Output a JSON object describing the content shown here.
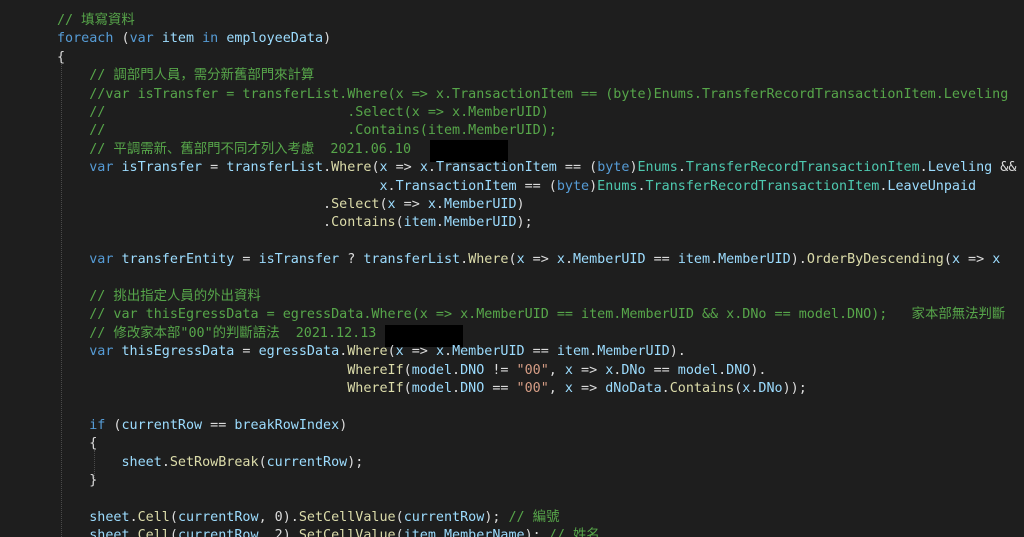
{
  "colors": {
    "background": "#1e1e1e",
    "comment": "#57a64a",
    "keyword": "#569cd6",
    "type": "#4ec9b0",
    "method": "#dcdcaa",
    "variable": "#9cdcfe",
    "string": "#d69d85",
    "plain": "#dcdcdc"
  },
  "lines": [
    [
      [
        "c",
        "// 填寫資料"
      ]
    ],
    [
      [
        "k",
        "foreach"
      ],
      [
        "p",
        " ("
      ],
      [
        "k",
        "var"
      ],
      [
        "p",
        " "
      ],
      [
        "v",
        "item"
      ],
      [
        "p",
        " "
      ],
      [
        "k",
        "in"
      ],
      [
        "p",
        " "
      ],
      [
        "v",
        "employeeData"
      ],
      [
        "p",
        ")"
      ]
    ],
    [
      [
        "p",
        "{"
      ]
    ],
    [
      [
        "c",
        "    // 調部門人員，需分新舊部門來計算"
      ]
    ],
    [
      [
        "c",
        "    //var isTransfer = transferList.Where(x => x.TransactionItem == (byte)Enums.TransferRecordTransactionItem.Leveling"
      ]
    ],
    [
      [
        "c",
        "    //                              .Select(x => x.MemberUID)"
      ]
    ],
    [
      [
        "c",
        "    //                              .Contains(item.MemberUID);"
      ]
    ],
    [
      [
        "c",
        "    // 平調需新、舊部門不同才列入考慮  2021.06.10"
      ]
    ],
    [
      [
        "p",
        "    "
      ],
      [
        "k",
        "var"
      ],
      [
        "p",
        " "
      ],
      [
        "v",
        "isTransfer"
      ],
      [
        "p",
        " = "
      ],
      [
        "v",
        "transferList"
      ],
      [
        "p",
        "."
      ],
      [
        "m",
        "Where"
      ],
      [
        "p",
        "("
      ],
      [
        "v",
        "x"
      ],
      [
        "p",
        " => "
      ],
      [
        "v",
        "x"
      ],
      [
        "p",
        "."
      ],
      [
        "v",
        "TransactionItem"
      ],
      [
        "p",
        " == ("
      ],
      [
        "k",
        "byte"
      ],
      [
        "p",
        ")"
      ],
      [
        "t",
        "Enums"
      ],
      [
        "p",
        "."
      ],
      [
        "t",
        "TransferRecordTransactionItem"
      ],
      [
        "p",
        "."
      ],
      [
        "v",
        "Leveling"
      ],
      [
        "p",
        " &&"
      ]
    ],
    [
      [
        "p",
        "                                        "
      ],
      [
        "v",
        "x"
      ],
      [
        "p",
        "."
      ],
      [
        "v",
        "TransactionItem"
      ],
      [
        "p",
        " == ("
      ],
      [
        "k",
        "byte"
      ],
      [
        "p",
        ")"
      ],
      [
        "t",
        "Enums"
      ],
      [
        "p",
        "."
      ],
      [
        "t",
        "TransferRecordTransactionItem"
      ],
      [
        "p",
        "."
      ],
      [
        "v",
        "LeaveUnpaid"
      ]
    ],
    [
      [
        "p",
        "                                 ."
      ],
      [
        "m",
        "Select"
      ],
      [
        "p",
        "("
      ],
      [
        "v",
        "x"
      ],
      [
        "p",
        " => "
      ],
      [
        "v",
        "x"
      ],
      [
        "p",
        "."
      ],
      [
        "v",
        "MemberUID"
      ],
      [
        "p",
        ")"
      ]
    ],
    [
      [
        "p",
        "                                 ."
      ],
      [
        "m",
        "Contains"
      ],
      [
        "p",
        "("
      ],
      [
        "v",
        "item"
      ],
      [
        "p",
        "."
      ],
      [
        "v",
        "MemberUID"
      ],
      [
        "p",
        ");"
      ]
    ],
    [],
    [
      [
        "p",
        "    "
      ],
      [
        "k",
        "var"
      ],
      [
        "p",
        " "
      ],
      [
        "v",
        "transferEntity"
      ],
      [
        "p",
        " = "
      ],
      [
        "v",
        "isTransfer"
      ],
      [
        "p",
        " ? "
      ],
      [
        "v",
        "transferList"
      ],
      [
        "p",
        "."
      ],
      [
        "m",
        "Where"
      ],
      [
        "p",
        "("
      ],
      [
        "v",
        "x"
      ],
      [
        "p",
        " => "
      ],
      [
        "v",
        "x"
      ],
      [
        "p",
        "."
      ],
      [
        "v",
        "MemberUID"
      ],
      [
        "p",
        " == "
      ],
      [
        "v",
        "item"
      ],
      [
        "p",
        "."
      ],
      [
        "v",
        "MemberUID"
      ],
      [
        "p",
        ")."
      ],
      [
        "m",
        "OrderByDescending"
      ],
      [
        "p",
        "("
      ],
      [
        "v",
        "x"
      ],
      [
        "p",
        " => "
      ],
      [
        "v",
        "x"
      ]
    ],
    [],
    [
      [
        "c",
        "    // 挑出指定人員的外出資料"
      ]
    ],
    [
      [
        "c",
        "    // var thisEgressData = egressData.Where(x => x.MemberUID == item.MemberUID && x.DNo == model.DNO);   家本部無法判斷"
      ]
    ],
    [
      [
        "c",
        "    // 修改家本部\"00\"的判斷語法  2021.12.13"
      ]
    ],
    [
      [
        "p",
        "    "
      ],
      [
        "k",
        "var"
      ],
      [
        "p",
        " "
      ],
      [
        "v",
        "thisEgressData"
      ],
      [
        "p",
        " = "
      ],
      [
        "v",
        "egressData"
      ],
      [
        "p",
        "."
      ],
      [
        "m",
        "Where"
      ],
      [
        "p",
        "("
      ],
      [
        "v",
        "x"
      ],
      [
        "p",
        " => "
      ],
      [
        "v",
        "x"
      ],
      [
        "p",
        "."
      ],
      [
        "v",
        "MemberUID"
      ],
      [
        "p",
        " == "
      ],
      [
        "v",
        "item"
      ],
      [
        "p",
        "."
      ],
      [
        "v",
        "MemberUID"
      ],
      [
        "p",
        ")."
      ]
    ],
    [
      [
        "p",
        "                                    "
      ],
      [
        "m",
        "WhereIf"
      ],
      [
        "p",
        "("
      ],
      [
        "v",
        "model"
      ],
      [
        "p",
        "."
      ],
      [
        "v",
        "DNO"
      ],
      [
        "p",
        " != "
      ],
      [
        "s",
        "\"00\""
      ],
      [
        "p",
        ", "
      ],
      [
        "v",
        "x"
      ],
      [
        "p",
        " => "
      ],
      [
        "v",
        "x"
      ],
      [
        "p",
        "."
      ],
      [
        "v",
        "DNo"
      ],
      [
        "p",
        " == "
      ],
      [
        "v",
        "model"
      ],
      [
        "p",
        "."
      ],
      [
        "v",
        "DNO"
      ],
      [
        "p",
        ")."
      ]
    ],
    [
      [
        "p",
        "                                    "
      ],
      [
        "m",
        "WhereIf"
      ],
      [
        "p",
        "("
      ],
      [
        "v",
        "model"
      ],
      [
        "p",
        "."
      ],
      [
        "v",
        "DNO"
      ],
      [
        "p",
        " == "
      ],
      [
        "s",
        "\"00\""
      ],
      [
        "p",
        ", "
      ],
      [
        "v",
        "x"
      ],
      [
        "p",
        " => "
      ],
      [
        "v",
        "dNoData"
      ],
      [
        "p",
        "."
      ],
      [
        "m",
        "Contains"
      ],
      [
        "p",
        "("
      ],
      [
        "v",
        "x"
      ],
      [
        "p",
        "."
      ],
      [
        "v",
        "DNo"
      ],
      [
        "p",
        "));"
      ]
    ],
    [],
    [
      [
        "p",
        "    "
      ],
      [
        "k",
        "if"
      ],
      [
        "p",
        " ("
      ],
      [
        "v",
        "currentRow"
      ],
      [
        "p",
        " == "
      ],
      [
        "v",
        "breakRowIndex"
      ],
      [
        "p",
        ")"
      ]
    ],
    [
      [
        "p",
        "    {"
      ]
    ],
    [
      [
        "p",
        "        "
      ],
      [
        "v",
        "sheet"
      ],
      [
        "p",
        "."
      ],
      [
        "m",
        "SetRowBreak"
      ],
      [
        "p",
        "("
      ],
      [
        "v",
        "currentRow"
      ],
      [
        "p",
        ");"
      ]
    ],
    [
      [
        "p",
        "    }"
      ]
    ],
    [],
    [
      [
        "p",
        "    "
      ],
      [
        "v",
        "sheet"
      ],
      [
        "p",
        "."
      ],
      [
        "m",
        "Cell"
      ],
      [
        "p",
        "("
      ],
      [
        "v",
        "currentRow"
      ],
      [
        "p",
        ", 0)."
      ],
      [
        "m",
        "SetCellValue"
      ],
      [
        "p",
        "("
      ],
      [
        "v",
        "currentRow"
      ],
      [
        "p",
        ");"
      ],
      [
        "c",
        " // 編號"
      ]
    ],
    [
      [
        "p",
        "    "
      ],
      [
        "v",
        "sheet"
      ],
      [
        "p",
        "."
      ],
      [
        "m",
        "Cell"
      ],
      [
        "p",
        "("
      ],
      [
        "v",
        "currentRow"
      ],
      [
        "p",
        ", 2)."
      ],
      [
        "m",
        "SetCellValue"
      ],
      [
        "p",
        "("
      ],
      [
        "v",
        "item"
      ],
      [
        "p",
        "."
      ],
      [
        "v",
        "MemberName"
      ],
      [
        "p",
        ");"
      ],
      [
        "c",
        " // 姓名"
      ]
    ]
  ]
}
